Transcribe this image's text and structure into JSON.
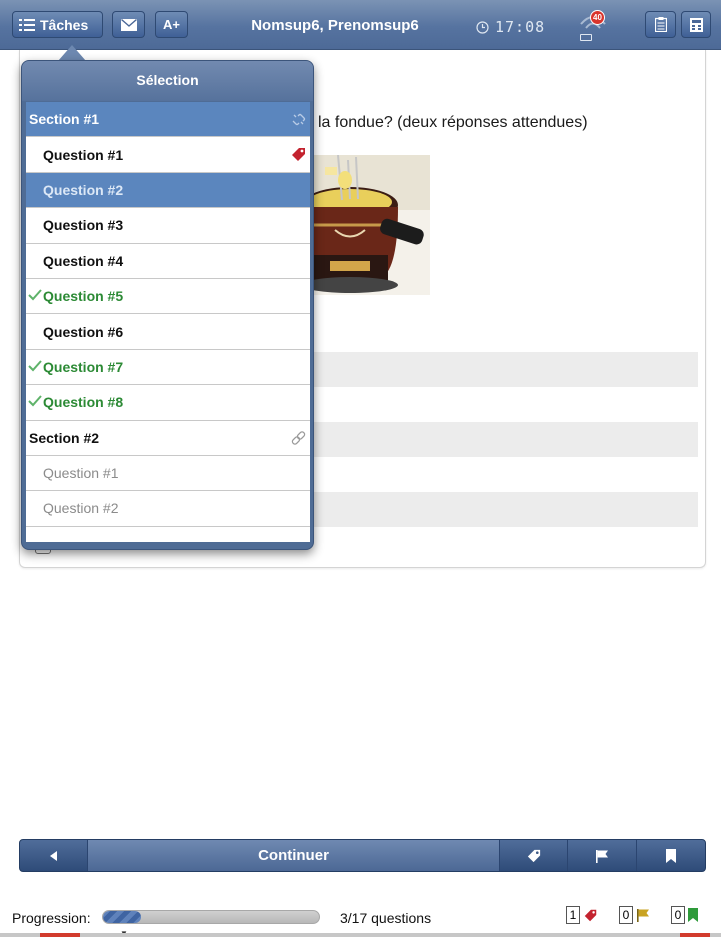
{
  "topbar": {
    "tasks_label": "Tâches",
    "font_label": "A+",
    "user_name": "Nomsup6, Prenomsup6",
    "time": "17:08",
    "notification_count": "40"
  },
  "question": {
    "text": "la fondue? (deux réponses attendues)"
  },
  "popover": {
    "title": "Sélection",
    "items": [
      {
        "label": "Section #1"
      },
      {
        "label": "Question #1"
      },
      {
        "label": "Question #2"
      },
      {
        "label": "Question #3"
      },
      {
        "label": "Question #4"
      },
      {
        "label": "Question #5"
      },
      {
        "label": "Question #6"
      },
      {
        "label": "Question #7"
      },
      {
        "label": "Question #8"
      },
      {
        "label": "Section #2"
      },
      {
        "label": "Question #1"
      },
      {
        "label": "Question #2"
      }
    ]
  },
  "nav": {
    "continue_label": "Continuer"
  },
  "progress": {
    "label": "Progression:",
    "fraction": 0.176,
    "count_text": "3/17 questions"
  },
  "stats": {
    "tagged": "1",
    "flagged": "0",
    "bookmarked": "0"
  },
  "colors": {
    "header_blue": "#5673a0",
    "selected_blue": "#5b86be",
    "done_green": "#2c8a35",
    "tag_red": "#c3232f",
    "flag_yellow": "#c9a322"
  }
}
